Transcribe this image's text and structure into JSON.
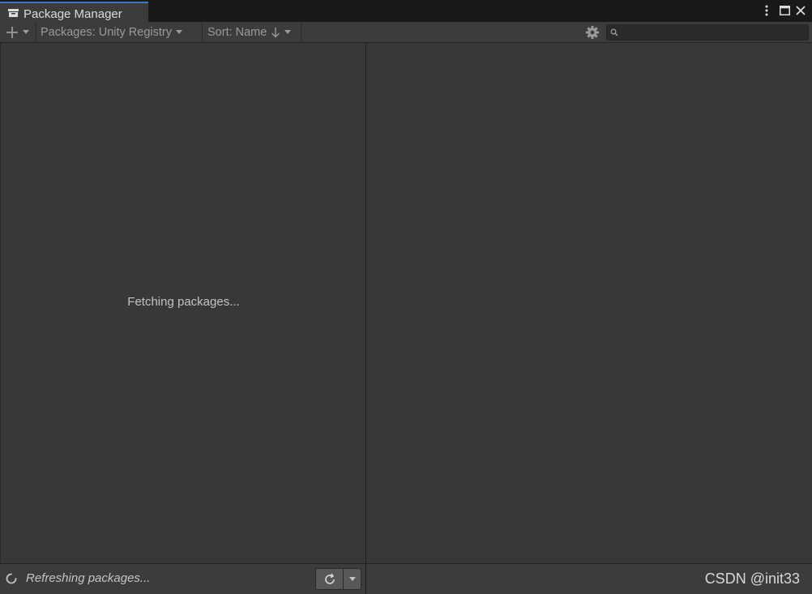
{
  "window": {
    "tab_title": "Package Manager",
    "tab_icon": "package-window-icon",
    "controls": [
      "more-options-icon",
      "maximize-icon",
      "close-icon"
    ]
  },
  "toolbar": {
    "add_icon": "plus-icon",
    "packages_dropdown": "Packages: Unity Registry",
    "sort_dropdown": "Sort: Name",
    "sort_direction_icon": "arrow-down-icon",
    "settings_icon": "gear-icon",
    "search": {
      "icon": "search-icon",
      "value": "",
      "placeholder": ""
    }
  },
  "package_list": {
    "message": "Fetching packages..."
  },
  "status_bar": {
    "spinner_icon": "loading-spinner-icon",
    "text": "Refreshing packages...",
    "refresh_icon": "refresh-icon",
    "refresh_menu_icon": "chevron-down-icon"
  },
  "watermark": "CSDN @init33",
  "colors": {
    "background": "#383838",
    "tab_accent": "#3a79bb",
    "toolbar": "#3c3c3c",
    "text": "#c4c4c4"
  }
}
